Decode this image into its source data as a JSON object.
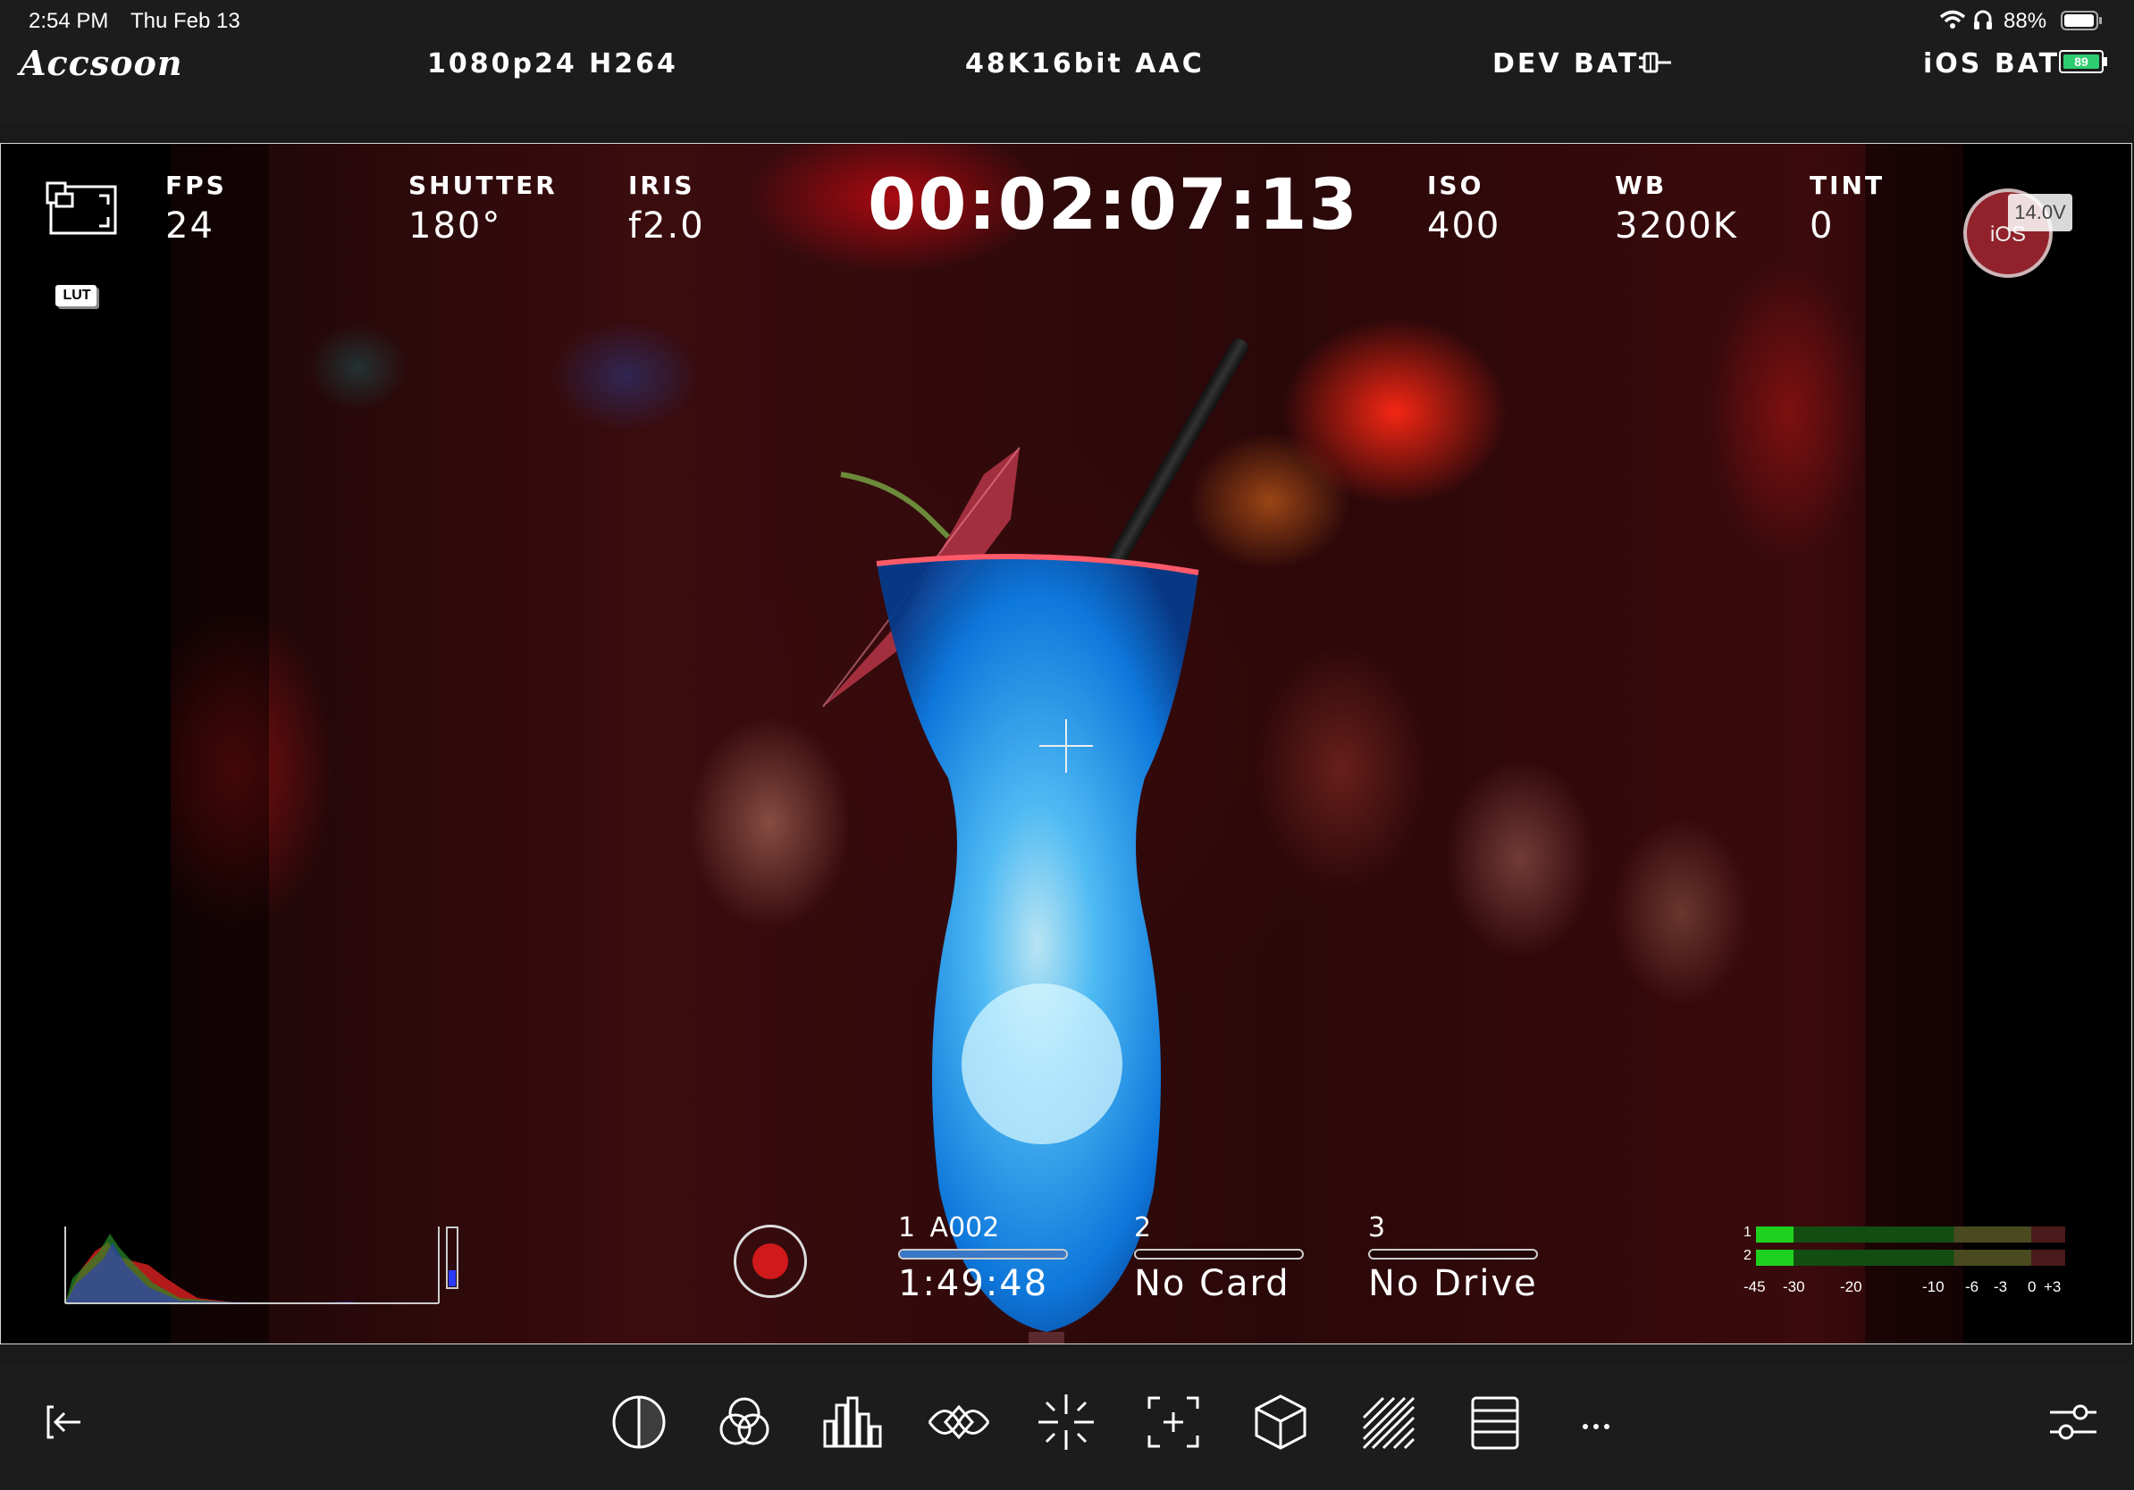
{
  "status_bar": {
    "time": "2:54 PM",
    "date": "Thu Feb 13",
    "battery_percent": "88%"
  },
  "header": {
    "logo": "Accsoon",
    "video_format": "1080p24 H264",
    "audio_format": "48K16bit AAC",
    "dev_bat_label": "DEV BAT",
    "ios_bat_label": "iOS BAT",
    "ios_bat_level": "89"
  },
  "overlay": {
    "fps": {
      "label": "FPS",
      "value": "24"
    },
    "shutter": {
      "label": "SHUTTER",
      "value": "180°"
    },
    "iris": {
      "label": "IRIS",
      "value": "f2.0"
    },
    "timecode": "00:02:07:13",
    "iso": {
      "label": "ISO",
      "value": "400"
    },
    "wb": {
      "label": "WB",
      "value": "3200K"
    },
    "tint": {
      "label": "TINT",
      "value": "0"
    },
    "lut_badge": "LUT",
    "voltage": "14.0V",
    "ios_badge": "iOS"
  },
  "recording": {
    "slots": [
      {
        "number": "1",
        "clip": "A002",
        "value": "1:49:48",
        "fill": 1.0
      },
      {
        "number": "2",
        "clip": "",
        "value": "No Card",
        "fill": 0
      },
      {
        "number": "3",
        "clip": "",
        "value": "No Drive",
        "fill": 0
      }
    ]
  },
  "audio_meter": {
    "channels": [
      "1",
      "2"
    ],
    "scale": [
      "-45",
      "-30",
      "-20",
      "-10",
      "-6",
      "-3",
      "0",
      "+3"
    ],
    "levels_db": [
      -30,
      -30
    ]
  },
  "toolbar": {
    "exit_icon": "exit-icon",
    "tools": [
      "zebra-icon",
      "rgb-parade-icon",
      "histogram-icon",
      "waveform-icon",
      "focus-peaking-icon",
      "frame-guide-icon",
      "lut-cube-icon",
      "false-color-icon",
      "vectorscope-list-icon",
      "more-icon"
    ],
    "settings_icon": "settings-sliders-icon"
  },
  "colors": {
    "record_red": "#d0191b",
    "meter_green": "#1fd11f",
    "ios_bat_green": "#2ecc71"
  }
}
